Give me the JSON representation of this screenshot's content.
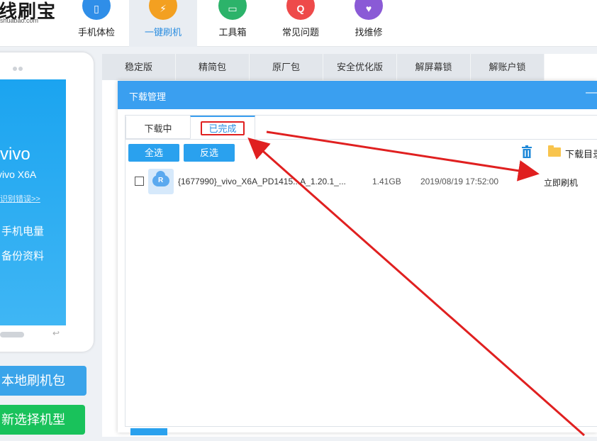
{
  "app": {
    "logo_text": "线刷宝",
    "logo_sub": "shuabao.com"
  },
  "nav": [
    {
      "label": "手机体检",
      "icon": "phone-check-icon",
      "color": "#2f8ee8"
    },
    {
      "label": "一键刷机",
      "icon": "flash-icon",
      "color": "#f3a021"
    },
    {
      "label": "工具箱",
      "icon": "toolbox-icon",
      "color": "#2cb36a"
    },
    {
      "label": "常见问题",
      "icon": "question-icon",
      "color": "#ee4a4a"
    },
    {
      "label": "找维修",
      "icon": "repair-icon",
      "color": "#8a5ad6"
    }
  ],
  "phone": {
    "brand": "vivo",
    "model": "vivo X6A",
    "wrong_link": "识别错误>>",
    "info1": "手机电量",
    "info2": "备份资料"
  },
  "left_buttons": {
    "local": "本地刷机包",
    "choose": "新选择机型"
  },
  "rom_tabs": [
    "稳定版",
    "精简包",
    "原厂包",
    "安全优化版",
    "解屏幕锁",
    "解账户锁"
  ],
  "dialog": {
    "title": "下载管理",
    "tabs": [
      "下载中",
      "已完成"
    ],
    "select_all": "全选",
    "invert": "反选",
    "download_dir": "下载目录",
    "files": [
      {
        "name": "{1677990}_vivo_X6A_PD1415...A_1.20.1_...",
        "size": "1.41GB",
        "date": "2019/08/19 17:52:00",
        "action": "立即刷机"
      }
    ]
  },
  "colors": {
    "accent": "#3a9ff0",
    "green": "#19c25b",
    "annotation": "#e02020"
  }
}
